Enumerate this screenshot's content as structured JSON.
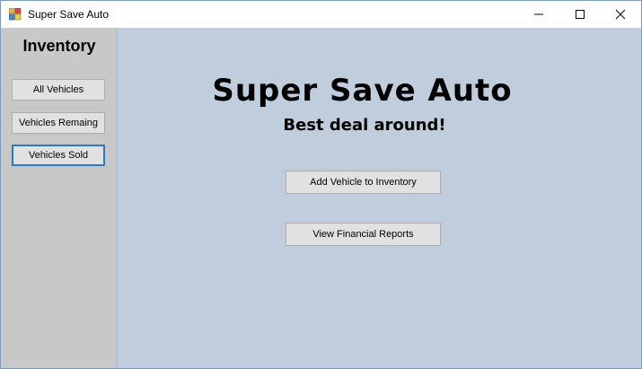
{
  "window": {
    "title": "Super Save Auto"
  },
  "sidebar": {
    "title": "Inventory",
    "items": [
      {
        "label": "All Vehicles"
      },
      {
        "label": "Vehicles Remaing"
      },
      {
        "label": "Vehicles Sold"
      }
    ]
  },
  "main": {
    "title": "Super Save Auto",
    "subtitle": "Best deal around!",
    "buttons": [
      {
        "label": "Add Vehicle to Inventory"
      },
      {
        "label": "View Financial Reports"
      }
    ]
  },
  "colors": {
    "sidebar_bg": "#c8c8c8",
    "main_bg": "#c0cddc",
    "button_bg": "#e1e1e1",
    "focus_border": "#2b78c8"
  }
}
